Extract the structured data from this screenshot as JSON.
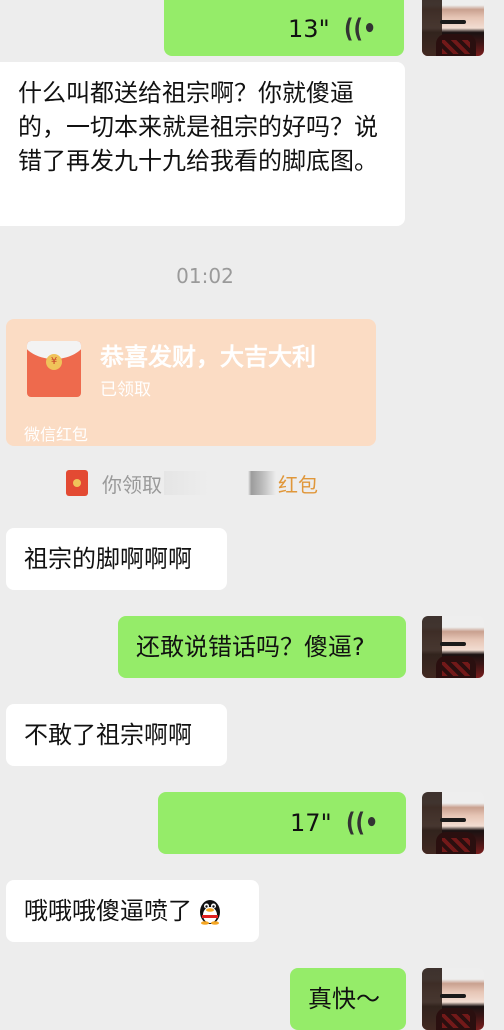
{
  "messages": {
    "voice_top_duration": "13\"",
    "text_1": "什么叫都送给祖宗啊？你就傻逼的，一切本来就是祖宗的好吗？说错了再发九十九给我看的脚底图。",
    "timestamp": "01:02",
    "red_packet": {
      "title": "恭喜发财，大吉大利",
      "status": "已领取",
      "footer": "微信红包"
    },
    "system_notice": {
      "prefix": "你领取",
      "suffix": "红包"
    },
    "text_2": "祖宗的脚啊啊啊",
    "text_3": "还敢说错话吗？傻逼?",
    "text_4": "不敢了祖宗啊啊",
    "voice_2_duration": "17\"",
    "text_5": "哦哦哦傻逼喷了",
    "text_6": "真快～"
  }
}
